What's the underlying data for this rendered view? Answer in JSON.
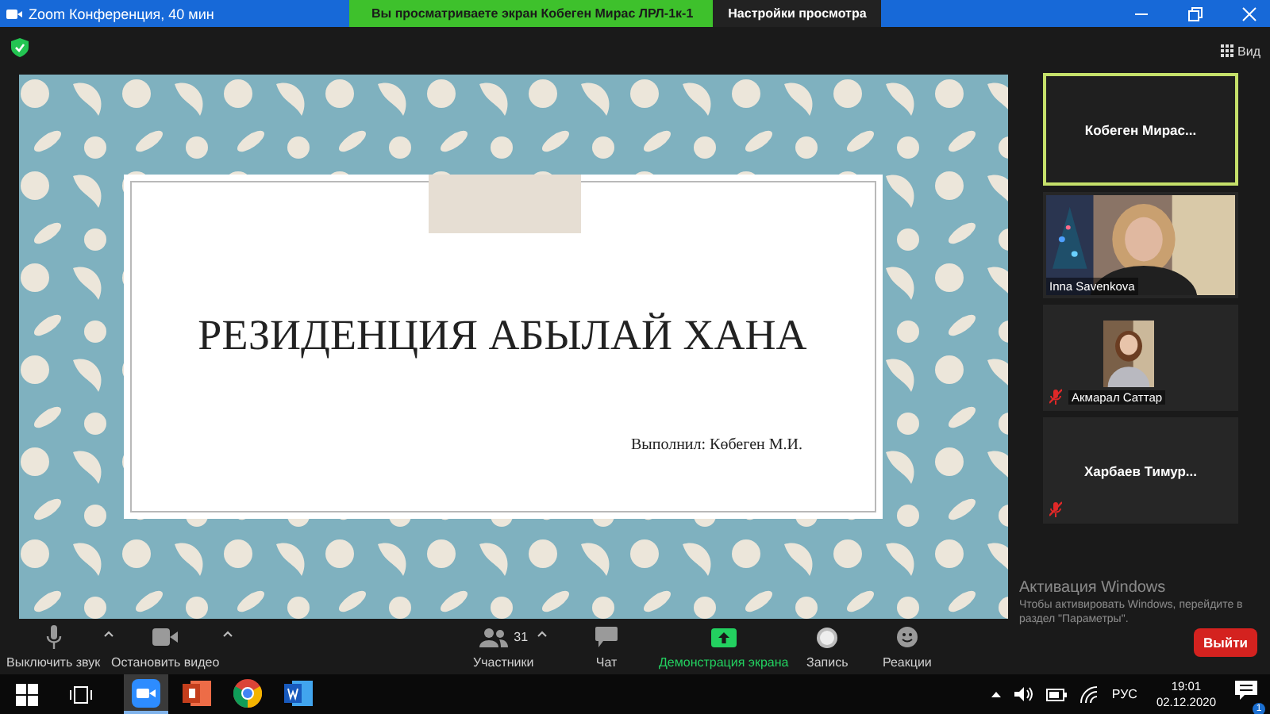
{
  "window": {
    "title": "Zoom Конференция, 40 мин"
  },
  "share_banner": {
    "text": "Вы просматриваете экран Кобеген Мирас ЛРЛ-1к-1",
    "options": "Настройки просмотра"
  },
  "view_button": "Вид",
  "slide": {
    "title": "РЕЗИДЕНЦИЯ АБЫЛАЙ ХАНА",
    "author": "Выполнил: Көбеген М.И."
  },
  "participants": [
    {
      "name": "Кобеген  Мирас...",
      "kind": "name",
      "active": true,
      "muted": false
    },
    {
      "name": "Inna Savenkova",
      "kind": "video",
      "active": false,
      "muted": false
    },
    {
      "name": "Акмарал Саттар",
      "active": false,
      "muted": true
    },
    {
      "name": "Харбаев  Тимур...",
      "kind": "name",
      "active": false,
      "muted": true
    }
  ],
  "toolbar": [
    {
      "label": "Выключить звук",
      "kind": "mic",
      "caret": true,
      "highlighted": false
    },
    {
      "label": "Остановить видео",
      "kind": "video",
      "caret": true,
      "highlighted": false
    },
    {
      "label": "Участники",
      "kind": "participants",
      "count": "31",
      "caret": true,
      "highlighted": false
    },
    {
      "label": "Чат",
      "kind": "chat",
      "caret": false,
      "highlighted": false
    },
    {
      "label": "Демонстрация экрана",
      "kind": "share",
      "caret": false,
      "highlighted": true
    },
    {
      "label": "Запись",
      "kind": "record",
      "caret": false,
      "highlighted": false
    },
    {
      "label": "Реакции",
      "kind": "reactions",
      "caret": false,
      "highlighted": false
    }
  ],
  "leave_button": "Выйти",
  "activation": {
    "title": "Активация Windows",
    "lines": [
      "Чтобы активировать Windows, перейдите в",
      "раздел \"Параметры\"."
    ]
  },
  "taskbar": {
    "apps": [
      {
        "kind": "zoom",
        "selected": true
      },
      {
        "kind": "powerpoint",
        "selected": false
      },
      {
        "kind": "chrome",
        "selected": false
      },
      {
        "kind": "word",
        "selected": false
      }
    ],
    "language": "РУС",
    "time": "19:01",
    "date": "02.12.2020",
    "notifications": "1"
  }
}
